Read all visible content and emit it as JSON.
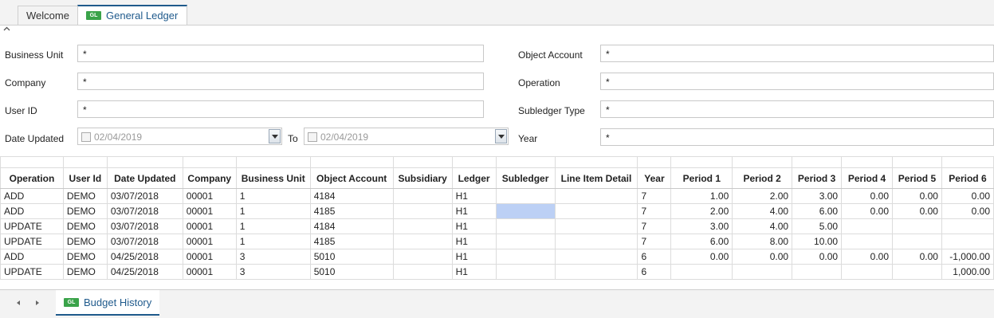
{
  "tabs": [
    {
      "label": "Welcome"
    },
    {
      "label": "General Ledger",
      "icon": "GL"
    }
  ],
  "filters": {
    "business_unit": {
      "label": "Business Unit",
      "value": "*"
    },
    "company": {
      "label": "Company",
      "value": "*"
    },
    "user_id": {
      "label": "User ID",
      "value": "*"
    },
    "date_updated": {
      "label": "Date Updated",
      "from": "02/04/2019",
      "to_label": "To",
      "to": "02/04/2019"
    },
    "object_account": {
      "label": "Object Account",
      "value": "*"
    },
    "operation": {
      "label": "Operation",
      "value": "*"
    },
    "subledger_type": {
      "label": "Subledger Type",
      "value": "*"
    },
    "year": {
      "label": "Year",
      "value": "*"
    }
  },
  "grid": {
    "columns": [
      "Operation",
      "User Id",
      "Date Updated",
      "Company",
      "Business Unit",
      "Object Account",
      "Subsidiary",
      "Ledger",
      "Subledger",
      "Line Item Detail",
      "Year",
      "Period 1",
      "Period 2",
      "Period 3",
      "Period 4",
      "Period 5",
      "Period 6"
    ],
    "rows": [
      [
        "ADD",
        "DEMO",
        "03/07/2018",
        "00001",
        "1",
        "4184",
        "",
        "H1",
        "",
        "",
        "7",
        "1.00",
        "2.00",
        "3.00",
        "0.00",
        "0.00",
        "0.00"
      ],
      [
        "ADD",
        "DEMO",
        "03/07/2018",
        "00001",
        "1",
        "4185",
        "",
        "H1",
        "",
        "",
        "7",
        "2.00",
        "4.00",
        "6.00",
        "0.00",
        "0.00",
        "0.00"
      ],
      [
        "UPDATE",
        "DEMO",
        "03/07/2018",
        "00001",
        "1",
        "4184",
        "",
        "H1",
        "",
        "",
        "7",
        "3.00",
        "4.00",
        "5.00",
        "",
        "",
        ""
      ],
      [
        "UPDATE",
        "DEMO",
        "03/07/2018",
        "00001",
        "1",
        "4185",
        "",
        "H1",
        "",
        "",
        "7",
        "6.00",
        "8.00",
        "10.00",
        "",
        "",
        ""
      ],
      [
        "ADD",
        "DEMO",
        "04/25/2018",
        "00001",
        "3",
        "5010",
        "",
        "H1",
        "",
        "",
        "6",
        "0.00",
        "0.00",
        "0.00",
        "0.00",
        "0.00",
        "-1,000.00"
      ],
      [
        "UPDATE",
        "DEMO",
        "04/25/2018",
        "00001",
        "3",
        "5010",
        "",
        "H1",
        "",
        "",
        "6",
        "",
        "",
        "",
        "",
        "",
        "1,000.00"
      ]
    ]
  },
  "bottom_tab": {
    "label": "Budget History",
    "icon": "GL"
  },
  "colors": {
    "accent": "#1f5a8c",
    "gl_icon": "#3aa34a",
    "selected_cell": "#bcd0f5"
  }
}
